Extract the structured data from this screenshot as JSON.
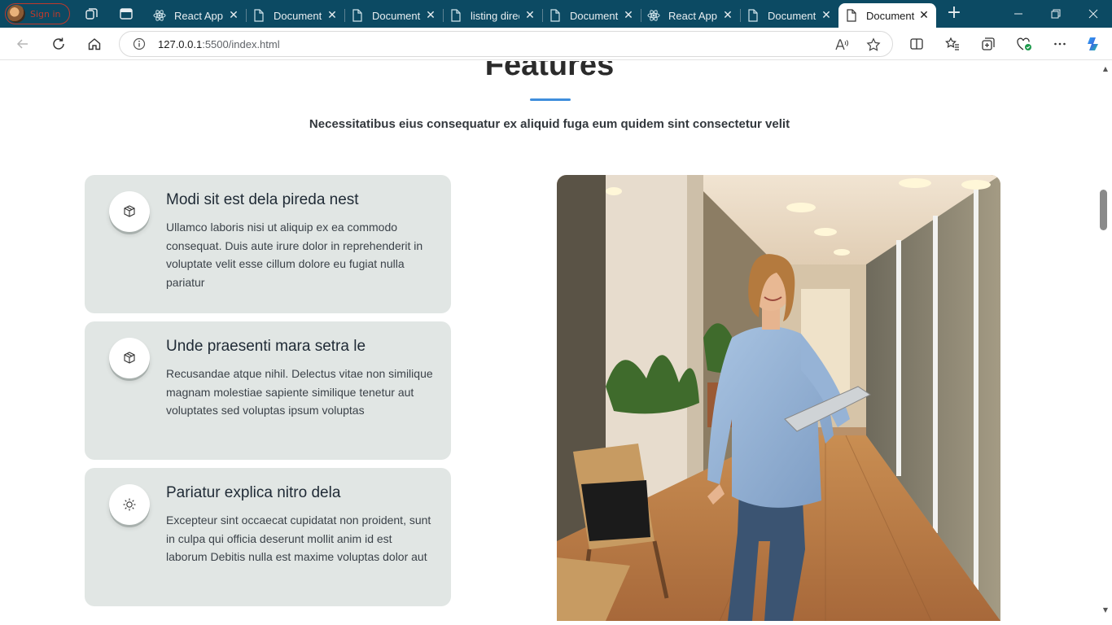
{
  "browser": {
    "profile_label": "Sign in",
    "tabs": [
      {
        "title": "React App",
        "icon": "react-icon"
      },
      {
        "title": "Document",
        "icon": "document-icon"
      },
      {
        "title": "Document",
        "icon": "document-icon"
      },
      {
        "title": "listing direc",
        "icon": "document-icon"
      },
      {
        "title": "Document",
        "icon": "document-icon"
      },
      {
        "title": "React App",
        "icon": "react-icon"
      },
      {
        "title": "Document",
        "icon": "document-icon"
      },
      {
        "title": "Document",
        "icon": "document-icon",
        "active": true
      }
    ],
    "url_host": "127.0.0.1",
    "url_rest": ":5500/index.html",
    "colors": {
      "titlebar": "#0c4a63",
      "accent": "#3f8edc"
    }
  },
  "page": {
    "section_title": "Features",
    "subtitle": "Necessitatibus eius consequatur ex aliquid fuga eum quidem sint consectetur velit",
    "features": [
      {
        "icon": "box-icon",
        "title": "Modi sit est dela pireda nest",
        "text": "Ullamco laboris nisi ut aliquip ex ea commodo consequat. Duis aute irure dolor in reprehenderit in voluptate velit esse cillum dolore eu fugiat nulla pariatur"
      },
      {
        "icon": "box-icon",
        "title": "Unde praesenti mara setra le",
        "text": "Recusandae atque nihil. Delectus vitae non similique magnam molestiae sapiente similique tenetur aut voluptates sed voluptas ipsum voluptas"
      },
      {
        "icon": "sun-icon",
        "title": "Pariatur explica nitro dela",
        "text": "Excepteur sint occaecat cupidatat non proident, sunt in culpa qui officia deserunt mollit anim id est laborum Debitis nulla est maxime voluptas dolor aut"
      }
    ]
  }
}
